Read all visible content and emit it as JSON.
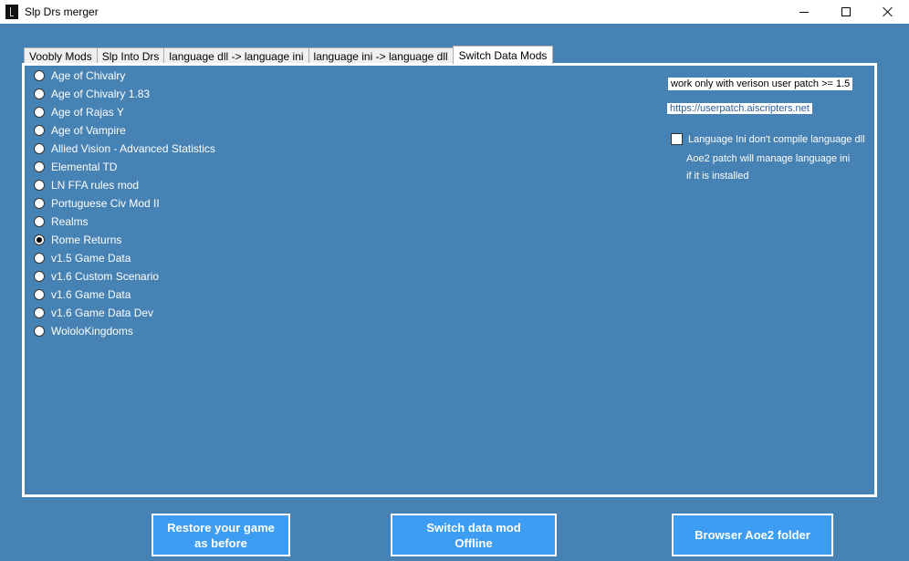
{
  "window": {
    "title": "Slp Drs merger",
    "controls": {
      "minimize": "minimize-icon",
      "maximize": "maximize-icon",
      "close": "close-icon"
    }
  },
  "tabs": [
    {
      "label": "Voobly Mods",
      "active": false
    },
    {
      "label": "Slp Into Drs",
      "active": false
    },
    {
      "label": "language dll -> language ini",
      "active": false
    },
    {
      "label": "language ini -> language dll",
      "active": false
    },
    {
      "label": "Switch Data Mods",
      "active": true
    }
  ],
  "mods": [
    {
      "label": "Age  of  Chivalry",
      "checked": false
    },
    {
      "label": "Age of Chivalry 1.83",
      "checked": false
    },
    {
      "label": "Age of Rajas Y",
      "checked": false
    },
    {
      "label": "Age of Vampire",
      "checked": false
    },
    {
      "label": "Allied Vision - Advanced Statistics",
      "checked": false
    },
    {
      "label": "Elemental TD",
      "checked": false
    },
    {
      "label": "LN FFA rules mod",
      "checked": false
    },
    {
      "label": "Portuguese Civ Mod II",
      "checked": false
    },
    {
      "label": "Realms",
      "checked": false
    },
    {
      "label": "Rome Returns",
      "checked": true
    },
    {
      "label": "v1.5 Game Data",
      "checked": false
    },
    {
      "label": "v1.6 Custom Scenario",
      "checked": false
    },
    {
      "label": "v1.6 Game Data",
      "checked": false
    },
    {
      "label": "v1.6 Game Data Dev",
      "checked": false
    },
    {
      "label": "WololoKingdoms",
      "checked": false
    }
  ],
  "side": {
    "note": "work only with verison user patch >= 1.5",
    "link": "https://userpatch.aiscripters.net",
    "checkbox_label": "Language Ini don't compile language dll",
    "checkbox_checked": false,
    "info_line1": "Aoe2 patch will manage language ini",
    "info_line2": "if it is installed"
  },
  "buttons": {
    "restore_line1": "Restore your game",
    "restore_line2": "as before",
    "switch_line1": "Switch data mod",
    "switch_line2": "Offline",
    "browse": "Browser Aoe2 folder"
  },
  "colors": {
    "background": "#4682b4",
    "button": "#3d9df2"
  }
}
